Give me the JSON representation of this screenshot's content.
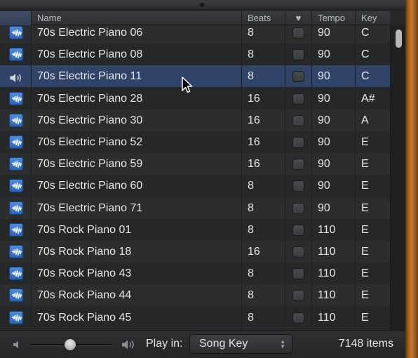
{
  "header": {
    "name": "Name",
    "beats": "Beats",
    "favorite": "♥",
    "tempo": "Tempo",
    "key": "Key"
  },
  "rows": [
    {
      "name": "70s Electric Piano 06",
      "beats": "8",
      "tempo": "90",
      "key": "C",
      "icon": "waveform-icon"
    },
    {
      "name": "70s Electric Piano 08",
      "beats": "8",
      "tempo": "90",
      "key": "C",
      "icon": "waveform-icon"
    },
    {
      "name": "70s Electric Piano 11",
      "beats": "8",
      "tempo": "90",
      "key": "C",
      "icon": "speaker-playing-icon",
      "selected": true
    },
    {
      "name": "70s Electric Piano 28",
      "beats": "16",
      "tempo": "90",
      "key": "A#",
      "icon": "waveform-icon"
    },
    {
      "name": "70s Electric Piano 30",
      "beats": "16",
      "tempo": "90",
      "key": "A",
      "icon": "waveform-icon"
    },
    {
      "name": "70s Electric Piano 52",
      "beats": "16",
      "tempo": "90",
      "key": "E",
      "icon": "waveform-icon"
    },
    {
      "name": "70s Electric Piano 59",
      "beats": "16",
      "tempo": "90",
      "key": "E",
      "icon": "waveform-icon"
    },
    {
      "name": "70s Electric Piano 60",
      "beats": "8",
      "tempo": "90",
      "key": "E",
      "icon": "waveform-icon"
    },
    {
      "name": "70s Electric Piano 71",
      "beats": "8",
      "tempo": "90",
      "key": "E",
      "icon": "waveform-icon"
    },
    {
      "name": "70s Rock Piano 01",
      "beats": "8",
      "tempo": "110",
      "key": "E",
      "icon": "waveform-icon"
    },
    {
      "name": "70s Rock Piano 18",
      "beats": "16",
      "tempo": "110",
      "key": "E",
      "icon": "waveform-icon"
    },
    {
      "name": "70s Rock Piano 43",
      "beats": "8",
      "tempo": "110",
      "key": "E",
      "icon": "waveform-icon"
    },
    {
      "name": "70s Rock Piano 44",
      "beats": "8",
      "tempo": "110",
      "key": "E",
      "icon": "waveform-icon"
    },
    {
      "name": "70s Rock Piano 45",
      "beats": "8",
      "tempo": "110",
      "key": "E",
      "icon": "waveform-icon"
    }
  ],
  "footer": {
    "play_in_label": "Play in:",
    "play_in_value": "Song Key",
    "item_count": "7148 items",
    "volume_level": 0.48
  },
  "colors": {
    "selection": "#2f4468",
    "waveform_icon": "#3a78d0"
  }
}
